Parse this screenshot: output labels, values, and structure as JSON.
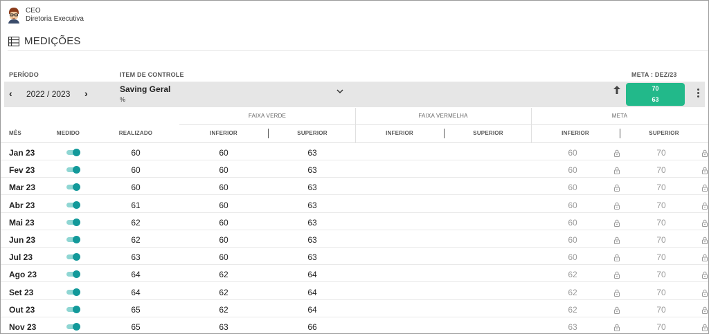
{
  "user": {
    "role": "CEO",
    "department": "Diretoria Executiva"
  },
  "page": {
    "title": "MEDIÇÕES"
  },
  "filters": {
    "period_label": "PERÍODO",
    "period_value": "2022 / 2023",
    "item_label": "ITEM DE CONTROLE",
    "item_name": "Saving Geral",
    "item_unit": "%",
    "meta_label": "META : DEZ/23",
    "meta_top": "70",
    "meta_bottom": "63",
    "colors": {
      "meta_box": "#22b98a",
      "toggle": "#12999a"
    }
  },
  "table": {
    "groups": {
      "faixa_verde": "FAIXA VERDE",
      "faixa_vermelha": "FAIXA VERMELHA",
      "meta": "META"
    },
    "headers": {
      "mes": "MÊS",
      "medido": "MEDIDO",
      "realizado": "REALIZADO",
      "verde_inferior": "INFERIOR",
      "verde_superior": "SUPERIOR",
      "vermelha_inferior": "INFERIOR",
      "vermelha_superior": "SUPERIOR",
      "meta_inferior": "INFERIOR",
      "meta_superior": "SUPERIOR"
    },
    "rows": [
      {
        "month": "Jan 23",
        "medido": true,
        "realizado": "60",
        "verde_inf": "60",
        "verde_sup": "63",
        "meta_inf": "60",
        "meta_sup": "70"
      },
      {
        "month": "Fev 23",
        "medido": true,
        "realizado": "60",
        "verde_inf": "60",
        "verde_sup": "63",
        "meta_inf": "60",
        "meta_sup": "70"
      },
      {
        "month": "Mar 23",
        "medido": true,
        "realizado": "60",
        "verde_inf": "60",
        "verde_sup": "63",
        "meta_inf": "60",
        "meta_sup": "70"
      },
      {
        "month": "Abr 23",
        "medido": true,
        "realizado": "61",
        "verde_inf": "60",
        "verde_sup": "63",
        "meta_inf": "60",
        "meta_sup": "70"
      },
      {
        "month": "Mai 23",
        "medido": true,
        "realizado": "62",
        "verde_inf": "60",
        "verde_sup": "63",
        "meta_inf": "60",
        "meta_sup": "70"
      },
      {
        "month": "Jun 23",
        "medido": true,
        "realizado": "62",
        "verde_inf": "60",
        "verde_sup": "63",
        "meta_inf": "60",
        "meta_sup": "70"
      },
      {
        "month": "Jul 23",
        "medido": true,
        "realizado": "63",
        "verde_inf": "60",
        "verde_sup": "63",
        "meta_inf": "60",
        "meta_sup": "70"
      },
      {
        "month": "Ago 23",
        "medido": true,
        "realizado": "64",
        "verde_inf": "62",
        "verde_sup": "64",
        "meta_inf": "62",
        "meta_sup": "70"
      },
      {
        "month": "Set 23",
        "medido": true,
        "realizado": "64",
        "verde_inf": "62",
        "verde_sup": "64",
        "meta_inf": "62",
        "meta_sup": "70"
      },
      {
        "month": "Out 23",
        "medido": true,
        "realizado": "65",
        "verde_inf": "62",
        "verde_sup": "64",
        "meta_inf": "62",
        "meta_sup": "70"
      },
      {
        "month": "Nov 23",
        "medido": true,
        "realizado": "65",
        "verde_inf": "63",
        "verde_sup": "66",
        "meta_inf": "63",
        "meta_sup": "70"
      }
    ]
  }
}
